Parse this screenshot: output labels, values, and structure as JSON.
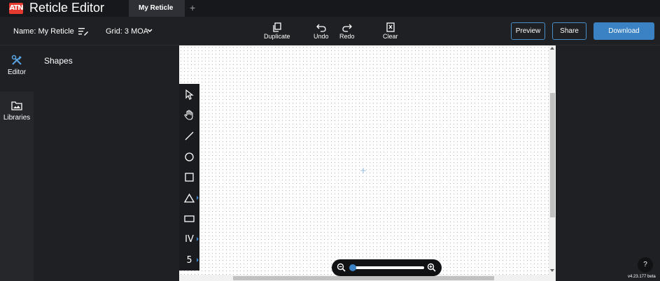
{
  "app": {
    "logo_text": "ATN",
    "title": "Reticle Editor"
  },
  "tabs": [
    {
      "label": "My Reticle"
    }
  ],
  "tab_add": "+",
  "toolbar": {
    "name_label": "Name: My Reticle",
    "grid_label": "Grid: 3 MOA",
    "duplicate": "Duplicate",
    "undo": "Undo",
    "redo": "Redo",
    "clear": "Clear",
    "preview": "Preview",
    "share": "Share",
    "download": "Download"
  },
  "sidebar": {
    "items": [
      {
        "label": "Editor",
        "icon": "tools-icon",
        "active": true
      },
      {
        "label": "Libraries",
        "icon": "folder-image-icon",
        "active": false
      }
    ]
  },
  "panel": {
    "title": "Shapes"
  },
  "palette": {
    "items": [
      {
        "icon": "pointer-icon"
      },
      {
        "icon": "hand-icon"
      },
      {
        "icon": "line-icon"
      },
      {
        "icon": "circle-icon"
      },
      {
        "icon": "square-icon"
      },
      {
        "icon": "triangle-icon",
        "submenu": true
      },
      {
        "icon": "rectangle-icon"
      },
      {
        "icon": "numeral-icon",
        "glyph": "IV",
        "submenu": true
      },
      {
        "icon": "digit-icon",
        "glyph": "5",
        "submenu": true
      }
    ]
  },
  "zoom": {
    "level": 0.0
  },
  "help": "?",
  "version": "v4.23.177 beta",
  "colors": {
    "accent": "#3a82c4",
    "logo": "#e53a30",
    "background": "#1f2023"
  }
}
